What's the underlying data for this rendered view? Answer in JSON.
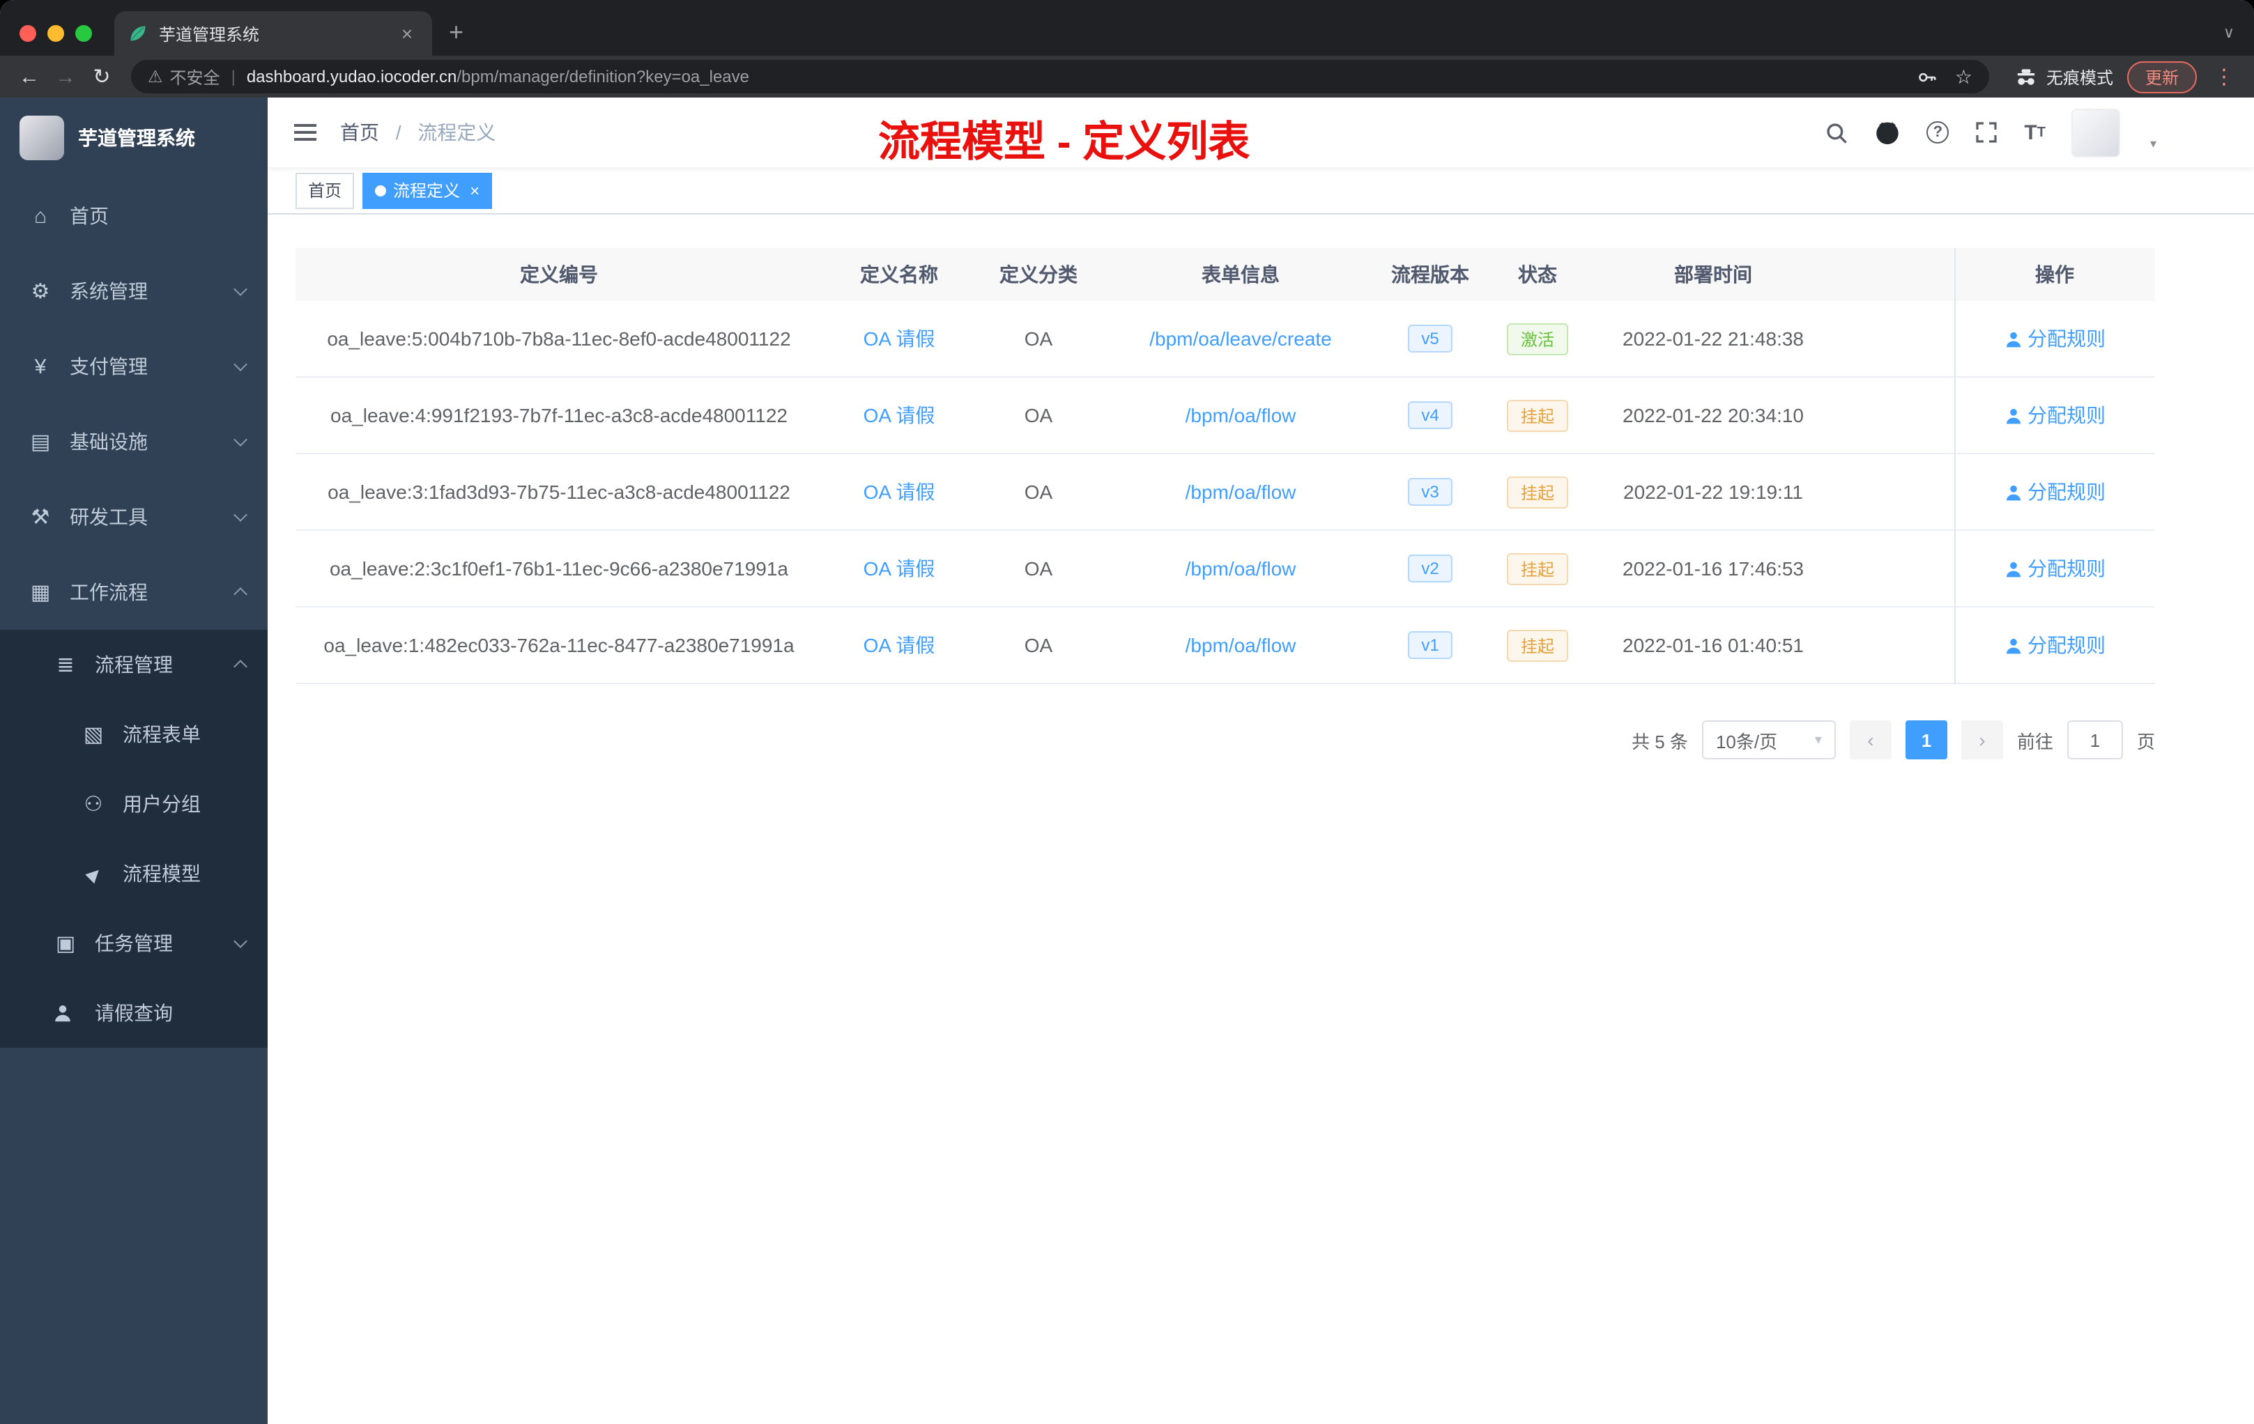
{
  "browser": {
    "tab_title": "芋道管理系统",
    "new_tab": "+",
    "back": "←",
    "forward": "→",
    "reload": "↻",
    "warning_icon": "⚠",
    "security": "不安全",
    "sep": "|",
    "host": "dashboard.yudao.iocoder.cn",
    "path": "/bpm/manager/definition?key=oa_leave",
    "star": "☆",
    "incognito": "无痕模式",
    "update": "更新",
    "menu_dots": "⋮",
    "tab_close": "×",
    "strip_caret": "∨"
  },
  "icons": {
    "home": "⌂",
    "system": "⚙",
    "payment": "¥",
    "infra": "▤",
    "devtools": "⚒",
    "workflow": "▦",
    "process_mgmt": "≣",
    "process_form": "▧",
    "user_group": "⚇",
    "process_model": "▶",
    "task_mgmt": "▣",
    "caret_down": "▾"
  },
  "sidebar": {
    "brand": "芋道管理系统",
    "menu": [
      {
        "label": "首页"
      },
      {
        "label": "系统管理"
      },
      {
        "label": "支付管理"
      },
      {
        "label": "基础设施"
      },
      {
        "label": "研发工具"
      },
      {
        "label": "工作流程"
      },
      {
        "label": "流程管理"
      },
      {
        "label": "流程表单"
      },
      {
        "label": "用户分组"
      },
      {
        "label": "流程模型"
      },
      {
        "label": "任务管理"
      },
      {
        "label": "请假查询"
      }
    ]
  },
  "header": {
    "breadcrumb_home": "首页",
    "breadcrumb_sep": "/",
    "breadcrumb_current": "流程定义",
    "annotation": "流程模型 - 定义列表",
    "fontsize_icon": "T"
  },
  "tags": {
    "home": "首页",
    "current": "流程定义",
    "close": "×"
  },
  "table": {
    "headers": [
      "定义编号",
      "定义名称",
      "定义分类",
      "表单信息",
      "流程版本",
      "状态",
      "部署时间",
      "操作"
    ],
    "rows": [
      {
        "id": "oa_leave:5:004b710b-7b8a-11ec-8ef0-acde48001122",
        "name": "OA 请假",
        "category": "OA",
        "form": "/bpm/oa/leave/create",
        "version": "v5",
        "status": "激活",
        "time": "2022-01-22 21:48:38",
        "action": "分配规则"
      },
      {
        "id": "oa_leave:4:991f2193-7b7f-11ec-a3c8-acde48001122",
        "name": "OA 请假",
        "category": "OA",
        "form": "/bpm/oa/flow",
        "version": "v4",
        "status": "挂起",
        "time": "2022-01-22 20:34:10",
        "action": "分配规则"
      },
      {
        "id": "oa_leave:3:1fad3d93-7b75-11ec-a3c8-acde48001122",
        "name": "OA 请假",
        "category": "OA",
        "form": "/bpm/oa/flow",
        "version": "v3",
        "status": "挂起",
        "time": "2022-01-22 19:19:11",
        "action": "分配规则"
      },
      {
        "id": "oa_leave:2:3c1f0ef1-76b1-11ec-9c66-a2380e71991a",
        "name": "OA 请假",
        "category": "OA",
        "form": "/bpm/oa/flow",
        "version": "v2",
        "status": "挂起",
        "time": "2022-01-16 17:46:53",
        "action": "分配规则"
      },
      {
        "id": "oa_leave:1:482ec033-762a-11ec-8477-a2380e71991a",
        "name": "OA 请假",
        "category": "OA",
        "form": "/bpm/oa/flow",
        "version": "v1",
        "status": "挂起",
        "time": "2022-01-16 01:40:51",
        "action": "分配规则"
      }
    ]
  },
  "pagination": {
    "total": "共 5 条",
    "size": "10条/页",
    "prev": "‹",
    "page": "1",
    "next": "›",
    "goto": "前往",
    "goto_value": "1",
    "unit": "页"
  },
  "colors": {
    "accent": "#409eff",
    "success": "#67c23a",
    "warning": "#e6a23c",
    "annotation_red": "#e8110e",
    "sidebar_bg": "#304156",
    "submenu_bg": "#1f2d3d"
  }
}
